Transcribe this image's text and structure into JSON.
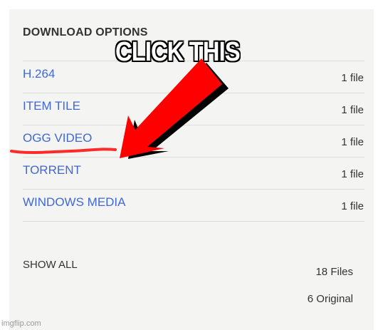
{
  "download_options": {
    "heading": "DOWNLOAD OPTIONS",
    "formats": [
      {
        "label": "H.264",
        "count": "1 file"
      },
      {
        "label": "ITEM TILE",
        "count": "1 file"
      },
      {
        "label": "OGG VIDEO",
        "count": "1 file"
      },
      {
        "label": "TORRENT",
        "count": "1 file"
      },
      {
        "label": "WINDOWS MEDIA",
        "count": "1 file"
      }
    ],
    "show_all": "SHOW ALL",
    "total_files": "18 Files",
    "original_files": "6 Original"
  },
  "meme": {
    "caption": "CLICK THIS",
    "arrow_color": "#ff0000",
    "underline_color": "#ff2a2a"
  },
  "watermark": "imgflip.com",
  "colors": {
    "link": "#4068d6",
    "text": "#333333",
    "panel_bg": "#f4f4f3"
  }
}
